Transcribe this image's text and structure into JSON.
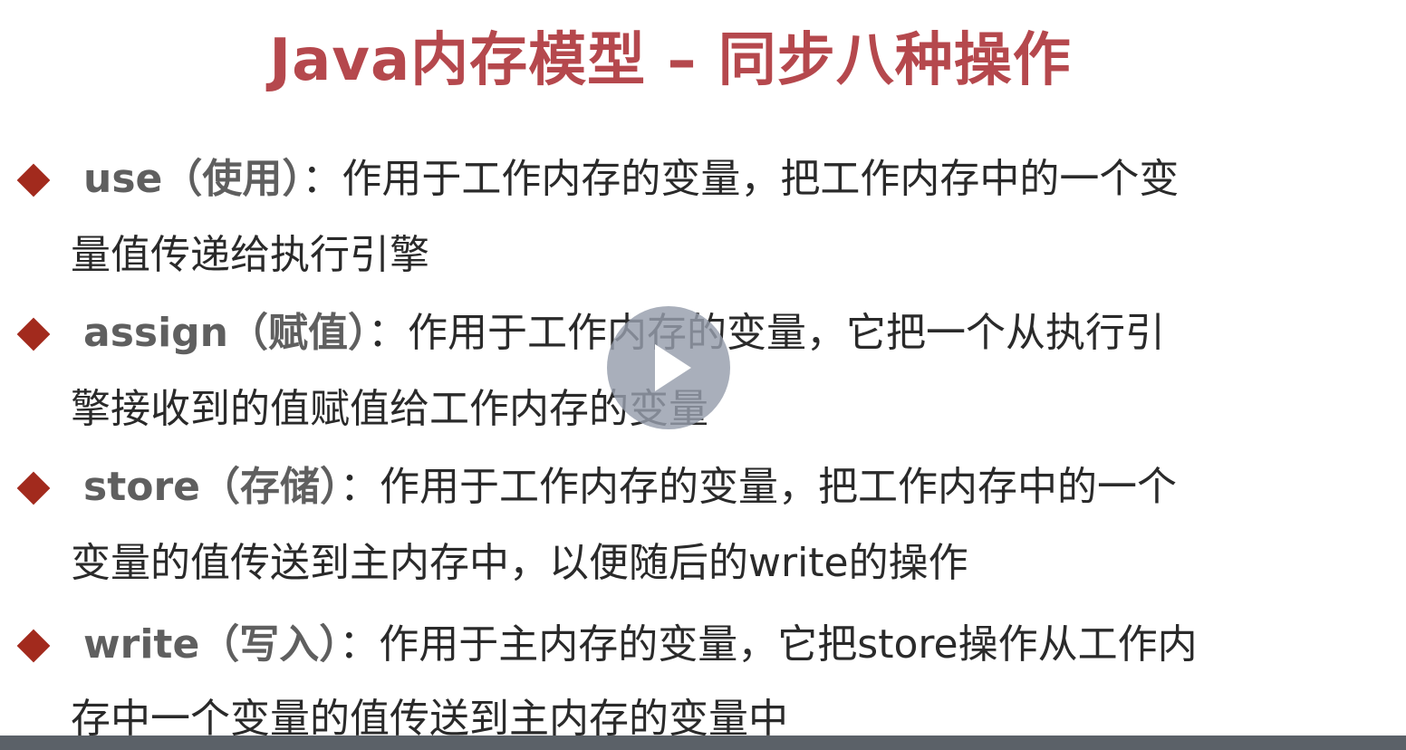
{
  "slide": {
    "title": "Java内存模型 – 同步八种操作",
    "items": [
      {
        "term": "use（使用）",
        "line1": "：作用于工作内存的变量，把工作内存中的一个变",
        "line2": "量值传递给执行引擎"
      },
      {
        "term": "assign（赋值）",
        "line1": "：作用于工作内存的变量，它把一个从执行引",
        "line2": "擎接收到的值赋值给工作内存的变量"
      },
      {
        "term": "store（存储）",
        "line1": "：作用于工作内存的变量，把工作内存中的一个",
        "line2": "变量的值传送到主内存中，以便随后的write的操作"
      },
      {
        "term": "write（写入）",
        "line1": "：作用于主内存的变量，它把store操作从工作内",
        "line2": "存中一个变量的值传送到主内存的变量中"
      }
    ]
  },
  "player": {
    "play_icon": "play-icon",
    "progress": 0
  },
  "colors": {
    "title": "#b5484d",
    "bullet": "#a22a1d",
    "body_text": "#2a2a2a",
    "term_text": "#5f5f5f",
    "control_bar": "#5b6168"
  }
}
